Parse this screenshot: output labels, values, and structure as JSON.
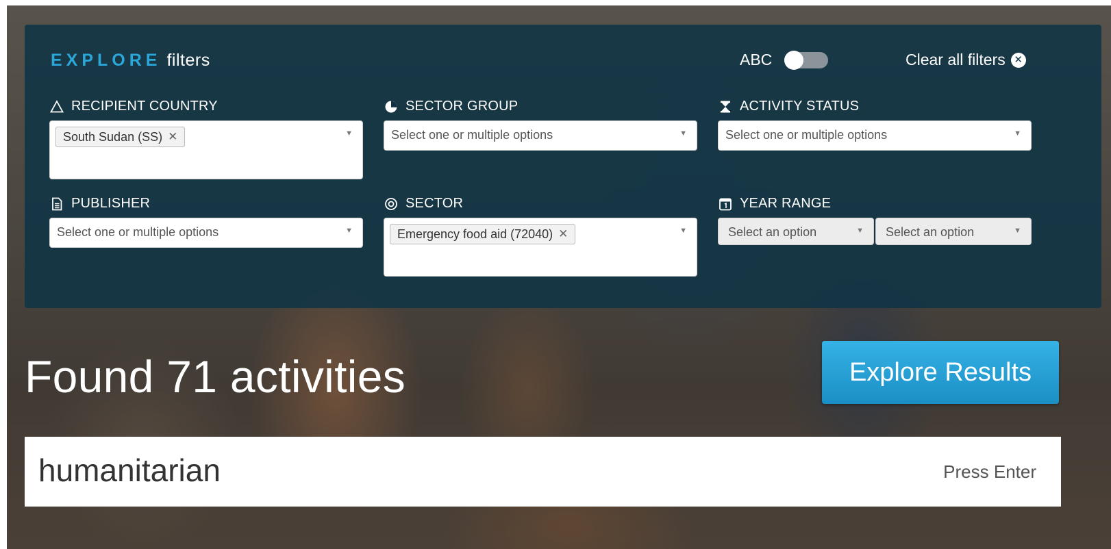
{
  "header": {
    "title_emphasis": "EXPLORE",
    "title_rest": "filters",
    "abc_label": "ABC",
    "clear_all_label": "Clear all filters",
    "clear_icon_glyph": "✕"
  },
  "filters": {
    "recipient_country": {
      "label": "RECIPIENT COUNTRY",
      "icon": "triangle-icon",
      "selected": [
        "South Sudan (SS)"
      ]
    },
    "sector_group": {
      "label": "SECTOR GROUP",
      "icon": "pie-chart-icon",
      "placeholder": "Select one or multiple options"
    },
    "activity_status": {
      "label": "ACTIVITY STATUS",
      "icon": "hourglass-icon",
      "placeholder": "Select one or multiple options"
    },
    "publisher": {
      "label": "PUBLISHER",
      "icon": "document-icon",
      "placeholder": "Select one or multiple options"
    },
    "sector": {
      "label": "SECTOR",
      "icon": "target-icon",
      "selected": [
        "Emergency food aid (72040)"
      ]
    },
    "year_range": {
      "label": "YEAR RANGE",
      "icon": "calendar-icon",
      "start_placeholder": "Select an option",
      "end_placeholder": "Select an option"
    }
  },
  "results": {
    "found_text": "Found 71 activities",
    "explore_button": "Explore Results"
  },
  "search": {
    "value": "humanitarian",
    "hint": "Press Enter"
  },
  "glyphs": {
    "remove": "✕",
    "dropdown": "▼"
  },
  "colors": {
    "panel": "#103446",
    "accent": "#2ba7d9",
    "button": "#1f9ad3"
  }
}
